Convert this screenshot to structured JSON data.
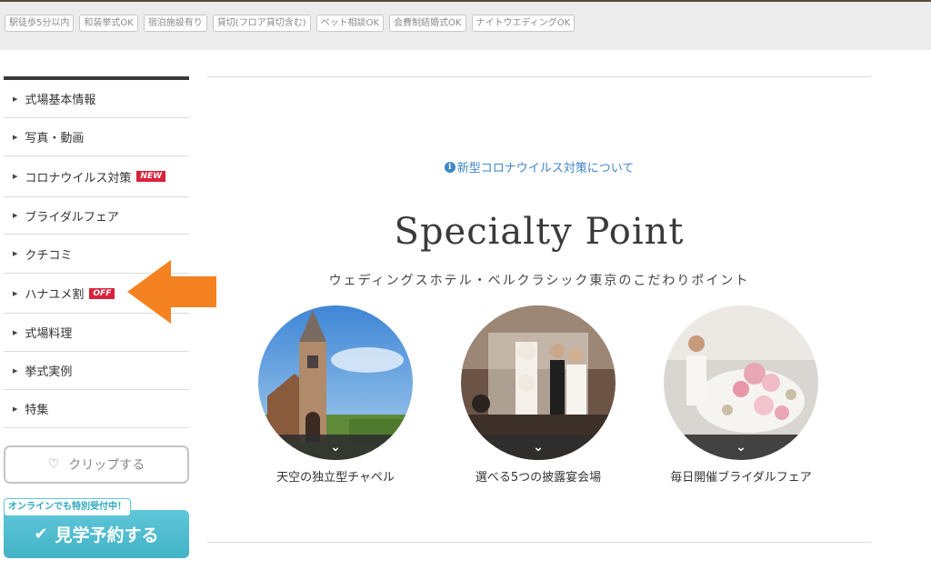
{
  "tags": [
    "駅徒歩5分以内",
    "和装挙式OK",
    "宿泊施設有り",
    "貸切(フロア貸切含む)",
    "ペット相談OK",
    "会費制結婚式OK",
    "ナイトウエディングOK"
  ],
  "sidebar": {
    "items": [
      {
        "label": "式場基本情報",
        "badge": ""
      },
      {
        "label": "写真・動画",
        "badge": ""
      },
      {
        "label": "コロナウイルス対策",
        "badge": "NEW"
      },
      {
        "label": "ブライダルフェア",
        "badge": ""
      },
      {
        "label": "クチコミ",
        "badge": ""
      },
      {
        "label": "ハナユメ割",
        "badge": "OFF"
      },
      {
        "label": "式場料理",
        "badge": ""
      },
      {
        "label": "挙式実例",
        "badge": ""
      },
      {
        "label": "特集",
        "badge": ""
      }
    ],
    "clip_label": "クリップする",
    "visit_bubble": "オンラインでも特別受付中！",
    "visit_label": "見学予約する"
  },
  "main": {
    "corona_link": "新型コロナウイルス対策について",
    "title": "Specialty Point",
    "subtitle": "ウェディングスホテル・ベルクラシック東京のこだわりポイント",
    "points": [
      {
        "caption": "天空の独立型チャペル"
      },
      {
        "caption": "選べる5つの披露宴会場"
      },
      {
        "caption": "毎日開催ブライダルフェア"
      }
    ]
  },
  "colors": {
    "accent_blue": "#3f86c7",
    "badge_red": "#d9223c",
    "visit_teal": "#4bbccf",
    "arrow_orange": "#f58220"
  }
}
